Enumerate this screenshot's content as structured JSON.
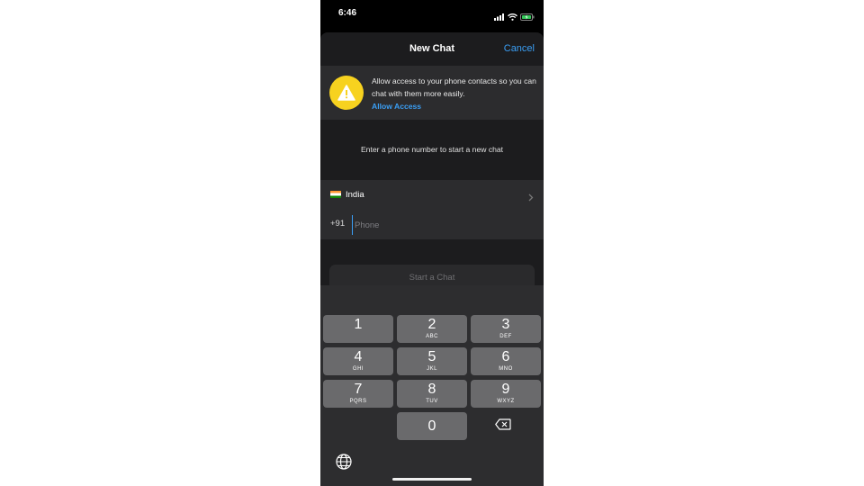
{
  "status_bar": {
    "time": "6:46"
  },
  "nav": {
    "title": "New Chat",
    "cancel": "Cancel"
  },
  "banner": {
    "message": "Allow access to your phone contacts so you can chat with them more easily.",
    "action": "Allow Access"
  },
  "hint": "Enter a phone number to start a new chat",
  "country": {
    "name": "India"
  },
  "phone": {
    "code": "+91",
    "placeholder": "Phone",
    "value": ""
  },
  "start_button": "Start a Chat",
  "keypad": [
    {
      "digit": "1",
      "letters": ""
    },
    {
      "digit": "2",
      "letters": "ABC"
    },
    {
      "digit": "3",
      "letters": "DEF"
    },
    {
      "digit": "4",
      "letters": "GHI"
    },
    {
      "digit": "5",
      "letters": "JKL"
    },
    {
      "digit": "6",
      "letters": "MNO"
    },
    {
      "digit": "7",
      "letters": "PQRS"
    },
    {
      "digit": "8",
      "letters": "TUV"
    },
    {
      "digit": "9",
      "letters": "WXYZ"
    },
    {
      "digit": "0",
      "letters": ""
    }
  ],
  "colors": {
    "accent": "#3a9ef4",
    "warning": "#f7d21f",
    "sheet": "#1c1c1e",
    "key": "#6a6a6c"
  },
  "icons": [
    "signal-icon",
    "wifi-icon",
    "battery-icon",
    "warning-icon",
    "chevron-right-icon",
    "backspace-icon",
    "globe-icon"
  ]
}
